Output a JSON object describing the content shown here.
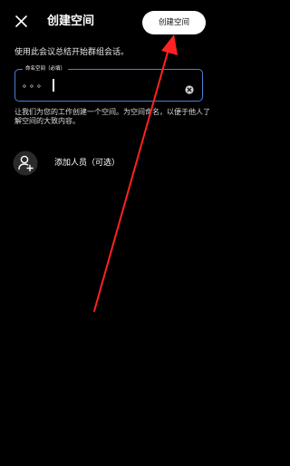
{
  "header": {
    "close_icon": "close-icon",
    "title": "创建空间",
    "create_button_label": "创建空间"
  },
  "instruction_text": "使用此会议总结开始群组会话。",
  "space_name_field": {
    "label": "命名空间（必填）",
    "value": "。。。",
    "border_color": "#4d7fd9",
    "clear_icon": "clear-circle-icon"
  },
  "hint_text": "让我们为您的工作创建一个空间。为空间命名，以便于他人了解空间的大致内容。",
  "add_people": {
    "icon": "add-person-icon",
    "label": "添加人员（可选）"
  },
  "annotation": {
    "arrow_color": "#ff2222"
  }
}
